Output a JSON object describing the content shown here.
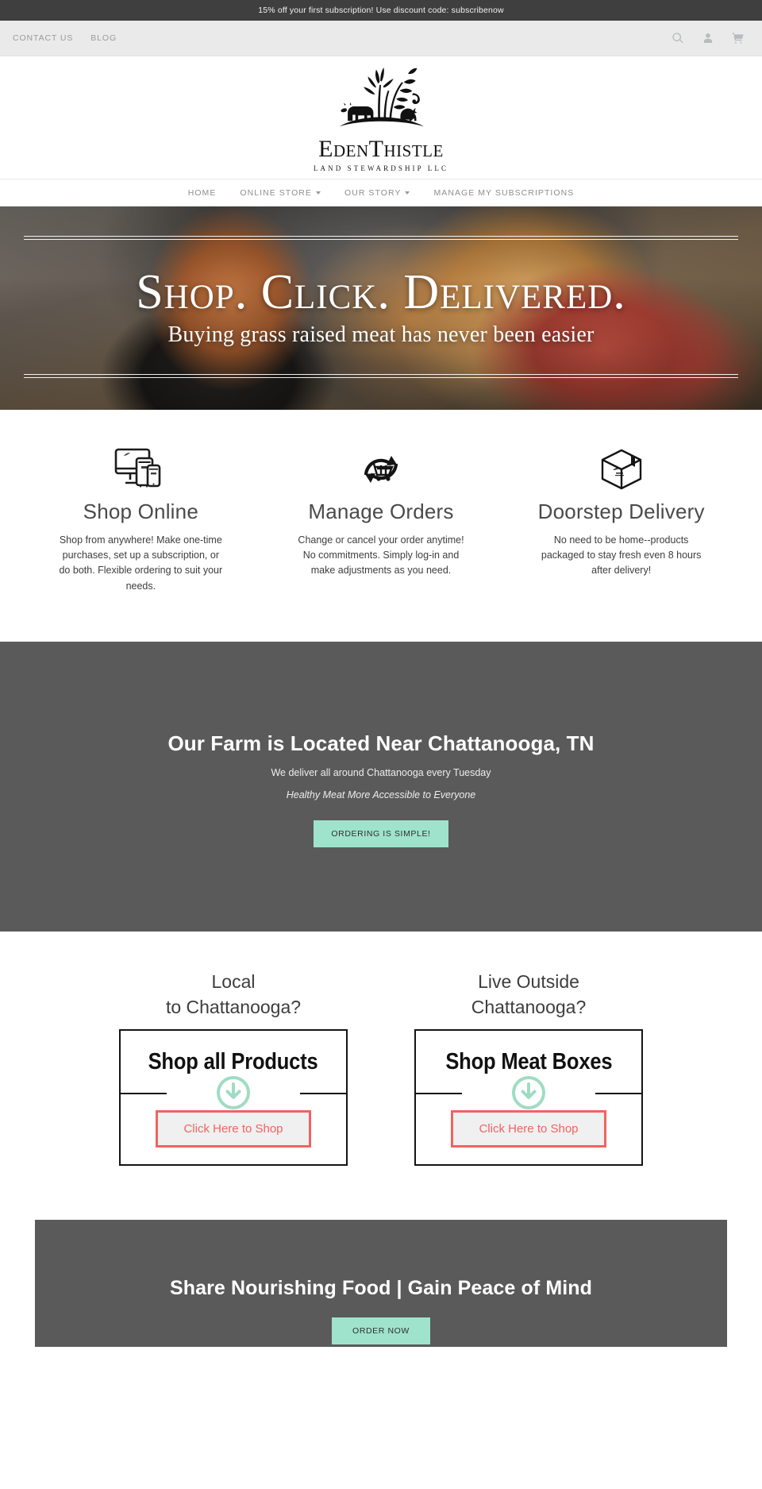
{
  "announcement": {
    "text": "15% off your first subscription! Use discount code: subscribenow"
  },
  "utilbar": {
    "links": [
      {
        "label": "CONTACT US"
      },
      {
        "label": "BLOG"
      }
    ],
    "icons": [
      {
        "name": "search-icon"
      },
      {
        "name": "account-icon"
      },
      {
        "name": "cart-icon"
      }
    ]
  },
  "brand": {
    "name": "EdenThistle",
    "tagline": "LAND STEWARDSHIP LLC"
  },
  "mainnav": {
    "items": [
      {
        "label": "HOME",
        "has_caret": false
      },
      {
        "label": "ONLINE STORE",
        "has_caret": true
      },
      {
        "label": "OUR STORY",
        "has_caret": true
      },
      {
        "label": "MANAGE MY SUBSCRIPTIONS",
        "has_caret": false
      }
    ]
  },
  "hero": {
    "headline": "Shop. Click. Delivered.",
    "subhead": "Buying grass raised meat has never been easier"
  },
  "features": [
    {
      "icon": "devices-icon",
      "title": "Shop Online",
      "body": "Shop from anywhere! Make one-time purchases, set up a subscription, or do both. Flexible ordering to suit your needs."
    },
    {
      "icon": "cart-refresh-icon",
      "title": "Manage Orders",
      "body": "Change or cancel your order anytime! No commitments. Simply log-in and make adjustments as you need."
    },
    {
      "icon": "package-box-icon",
      "title": "Doorstep Delivery",
      "body": "No need to be home--products packaged to stay fresh even 8 hours after delivery!"
    }
  ],
  "location_band": {
    "heading": "Our Farm is Located Near Chattanooga, TN",
    "line1": "We deliver all around Chattanooga every Tuesday",
    "line2": "Healthy Meat More Accessible to Everyone",
    "cta": "ORDERING IS SIMPLE!"
  },
  "shop_choice": [
    {
      "title_line1": "Local",
      "title_line2": "to Chattanooga?",
      "box_label": "Shop all Products",
      "button": "Click Here to Shop",
      "arrow_icon": "arrow-down-circle-icon"
    },
    {
      "title_line1": "Live Outside",
      "title_line2": "Chattanooga?",
      "box_label": "Shop Meat Boxes",
      "button": "Click Here to Shop",
      "arrow_icon": "arrow-down-circle-icon"
    }
  ],
  "bottom_band": {
    "heading": "Share Nourishing Food | Gain Peace of Mind",
    "cta": "ORDER NOW"
  },
  "colors": {
    "announce_bg": "#3f3f3f",
    "utilbar_bg": "#eaeaea",
    "dark_band": "#5a5a5a",
    "mint": "#9fe3cd",
    "coral": "#ef6461"
  }
}
